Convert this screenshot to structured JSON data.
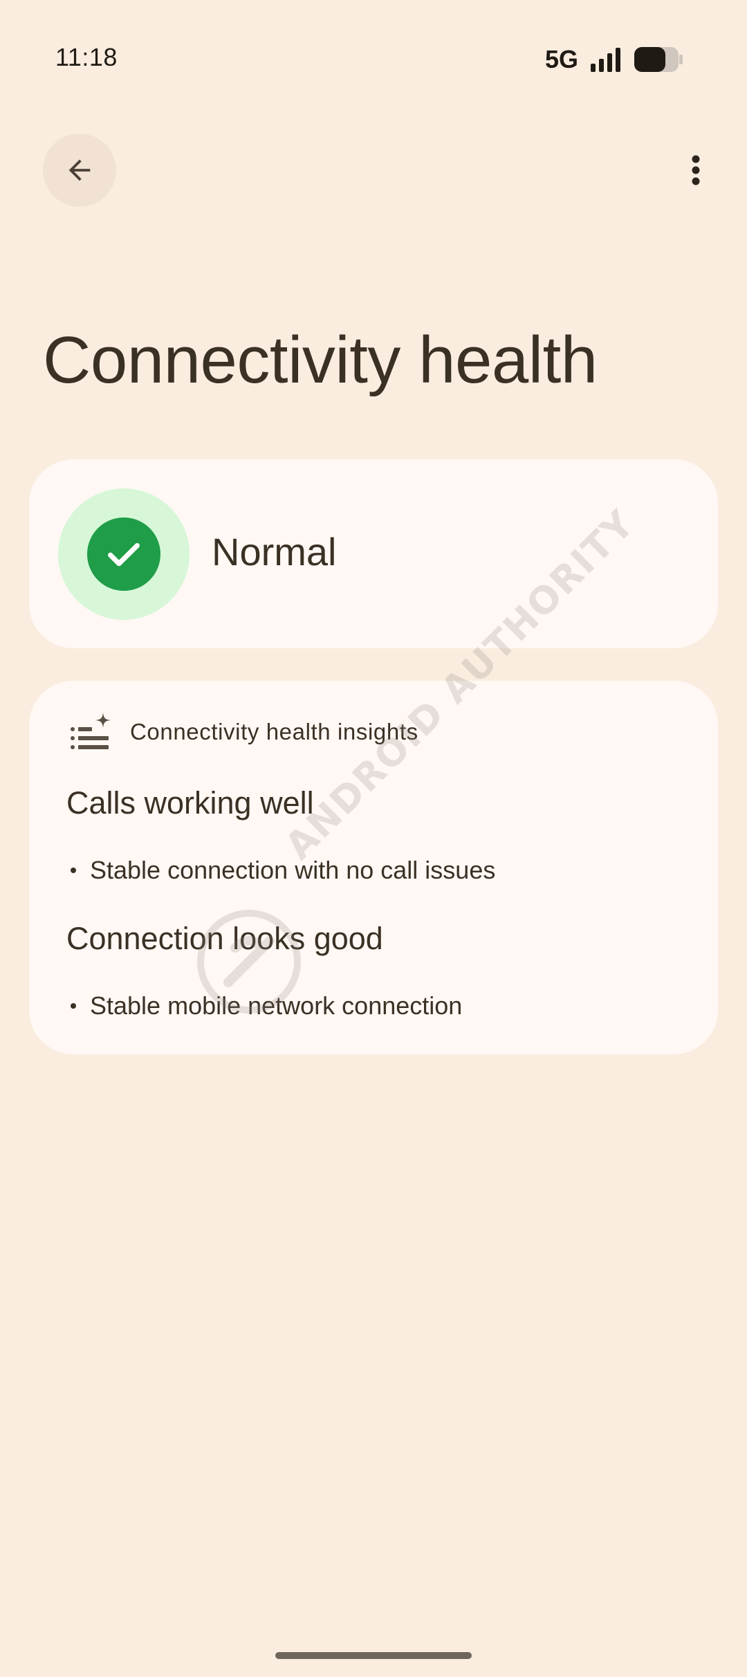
{
  "status_bar": {
    "time": "11:18",
    "network": "5G",
    "signal_icon": "signal-bars-icon",
    "battery_icon": "battery-icon",
    "battery_level": 0.7
  },
  "app_bar": {
    "back_icon": "arrow-back-icon",
    "more_icon": "more-vert-icon"
  },
  "page": {
    "title": "Connectivity health"
  },
  "status_card": {
    "icon": "check-circle-icon",
    "label": "Normal",
    "accent_color": "#1f9d48",
    "halo_color": "#d7f7d8"
  },
  "insights": {
    "icon": "list-sparkle-icon",
    "title": "Connectivity health insights",
    "items": [
      {
        "heading": "Calls working well",
        "bullet": "Stable connection with no call issues"
      },
      {
        "heading": "Connection looks good",
        "bullet": "Stable mobile network connection"
      }
    ]
  },
  "watermark": {
    "text": "ANDROID AUTHORITY"
  },
  "colors": {
    "background": "#faeddf",
    "card": "#fff8f4",
    "text": "#3a3024"
  }
}
